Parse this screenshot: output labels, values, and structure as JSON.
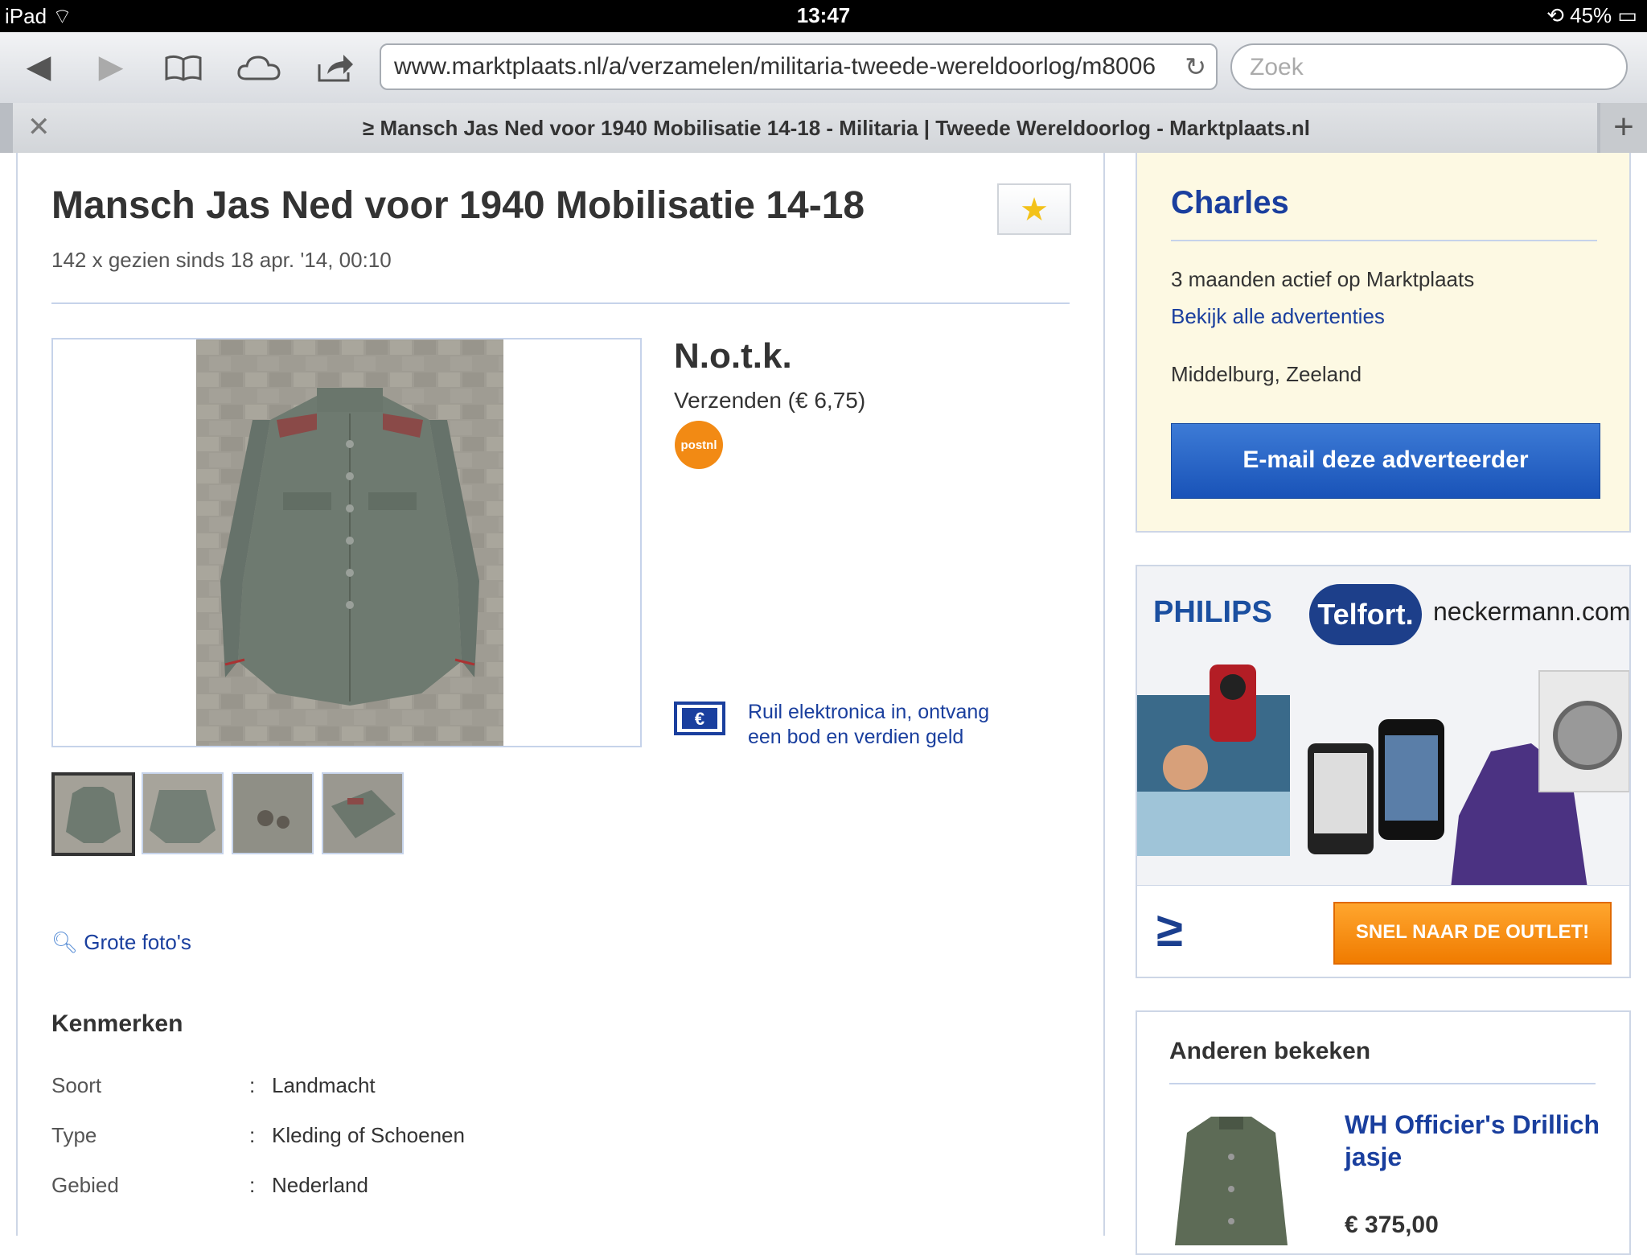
{
  "status": {
    "device": "iPad",
    "time": "13:47",
    "battery": "45%"
  },
  "browser": {
    "url": "www.marktplaats.nl/a/verzamelen/militaria-tweede-wereldoorlog/m8006",
    "search_placeholder": "Zoek",
    "tab_title": "≥ Mansch Jas Ned voor 1940 Mobilisatie 14-18 - Militaria | Tweede Wereldoorlog - Marktplaats.nl"
  },
  "listing": {
    "title": "Mansch Jas Ned voor 1940 Mobilisatie 14-18",
    "views": "142 x gezien sinds 18 apr. '14, 00:10",
    "price": "N.o.t.k.",
    "shipping": "Verzenden (€ 6,75)",
    "postnl_label": "postnl",
    "trade_in": "Ruil elektronica in, ontvang een bod en verdien geld",
    "large_photos": "Grote foto's",
    "features_title": "Kenmerken",
    "features": [
      {
        "label": "Soort",
        "value": "Landmacht"
      },
      {
        "label": "Type",
        "value": "Kleding of Schoenen"
      },
      {
        "label": "Gebied",
        "value": "Nederland"
      }
    ]
  },
  "seller": {
    "name": "Charles",
    "active": "3 maanden actief op Marktplaats",
    "all_ads": "Bekijk alle advertenties",
    "location": "Middelburg, Zeeland",
    "email_button": "E-mail deze adverteerder"
  },
  "ad": {
    "brand1": "PHILIPS",
    "brand2": "Telfort.",
    "brand3": "neckermann.com",
    "cta": "SNEL NAAR DE OUTLET!"
  },
  "others": {
    "title": "Anderen bekeken",
    "item_name": "WH Officier's Drillich jasje",
    "item_price": "€ 375,00"
  },
  "colors": {
    "link": "#1a3f9e",
    "button_blue": "#1953b8",
    "seller_bg": "#fdf9e3",
    "outlet_orange": "#f07b00"
  }
}
